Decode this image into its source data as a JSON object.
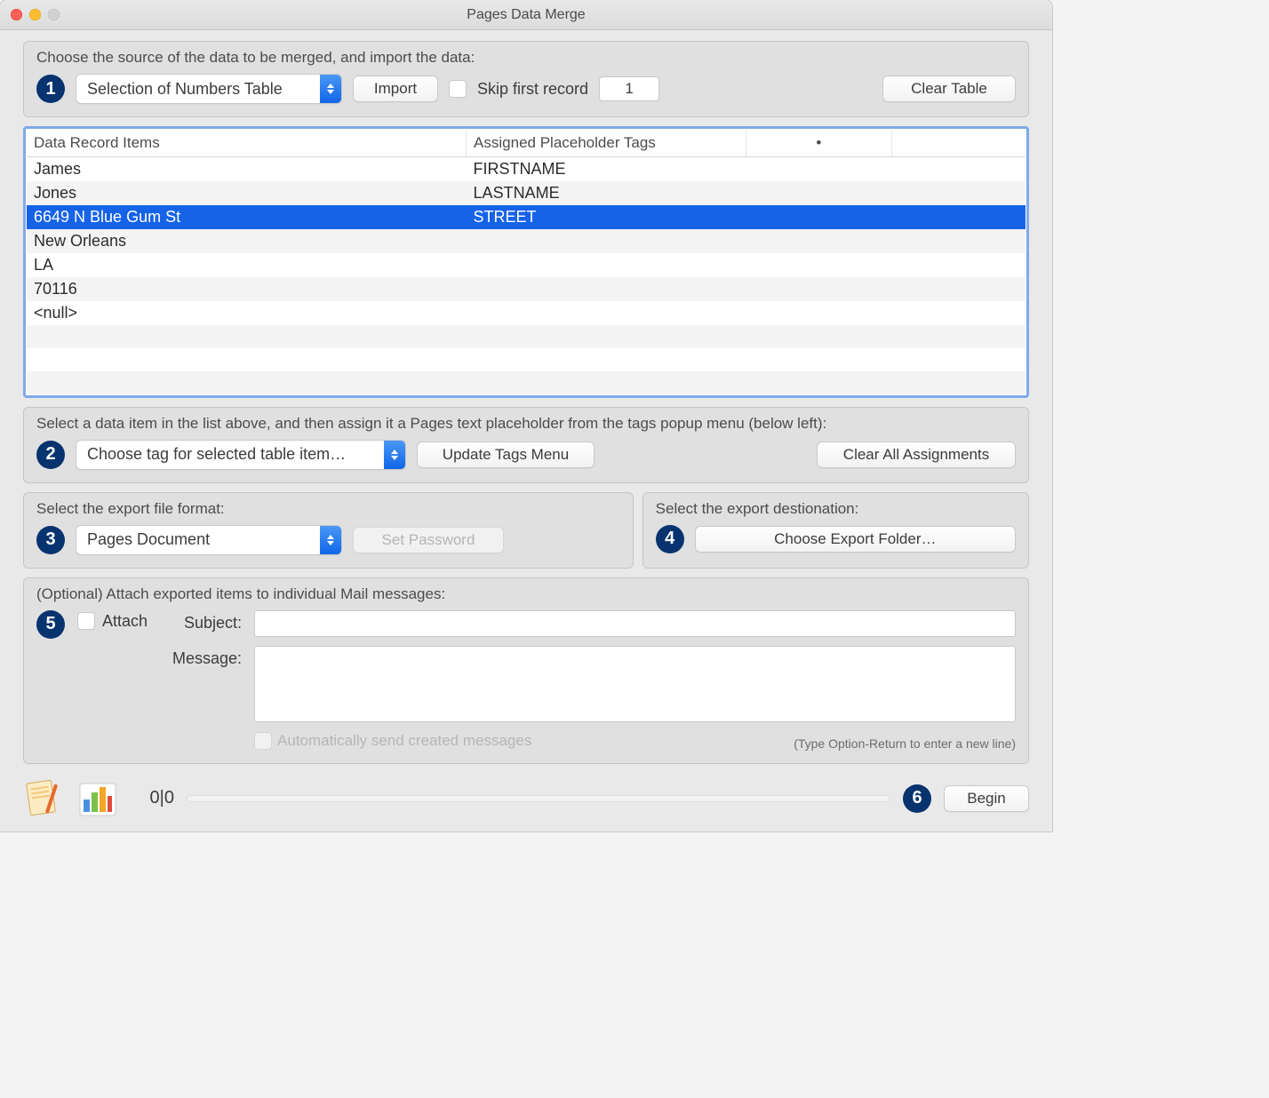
{
  "window": {
    "title": "Pages Data Merge"
  },
  "section1": {
    "label": "Choose the source of the data to be merged, and import the data:",
    "source_select": "Selection of Numbers Table",
    "import_btn": "Import",
    "skip_label": "Skip first record",
    "record_index": "1",
    "clear_btn": "Clear Table"
  },
  "table": {
    "headers": {
      "items": "Data Record Items",
      "tags": "Assigned Placeholder Tags",
      "dot": "•",
      "blank": ""
    },
    "rows": [
      {
        "item": "James",
        "tag": "FIRSTNAME",
        "selected": false,
        "stripe": "even"
      },
      {
        "item": "Jones",
        "tag": "LASTNAME",
        "selected": false,
        "stripe": "odd"
      },
      {
        "item": "6649 N Blue Gum St",
        "tag": "STREET",
        "selected": true,
        "stripe": "even"
      },
      {
        "item": "New Orleans",
        "tag": "",
        "selected": false,
        "stripe": "odd"
      },
      {
        "item": "LA",
        "tag": "",
        "selected": false,
        "stripe": "even"
      },
      {
        "item": "70116",
        "tag": "",
        "selected": false,
        "stripe": "odd"
      },
      {
        "item": "<null>",
        "tag": "",
        "selected": false,
        "stripe": "even"
      }
    ]
  },
  "section2": {
    "label": "Select a data item in the list above, and then assign it a Pages text placeholder from the tags popup menu (below left):",
    "tag_select": "Choose tag for selected table item…",
    "update_btn": "Update Tags Menu",
    "clear_btn": "Clear All Assignments"
  },
  "section3": {
    "label": "Select the export file format:",
    "format_select": "Pages Document",
    "password_btn": "Set Password"
  },
  "section4": {
    "label": "Select the export destionation:",
    "choose_btn": "Choose Export Folder…"
  },
  "section5": {
    "label": "(Optional) Attach exported items to individual Mail messages:",
    "attach_label": "Attach",
    "subject_label": "Subject:",
    "message_label": "Message:",
    "auto_send_label": "Automatically send created messages",
    "hint": "(Type Option-Return to enter a new line)"
  },
  "footer": {
    "count": "0|0",
    "begin_btn": "Begin"
  },
  "steps": {
    "s1": "1",
    "s2": "2",
    "s3": "3",
    "s4": "4",
    "s5": "5",
    "s6": "6"
  }
}
